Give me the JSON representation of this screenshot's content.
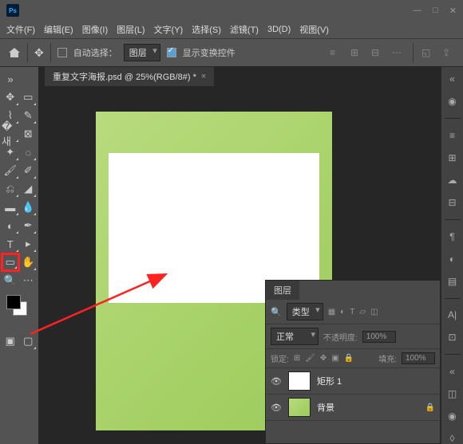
{
  "app": {
    "logo": "Ps"
  },
  "window_controls": {
    "min": "—",
    "max": "□",
    "close": "✕"
  },
  "menu": [
    "文件(F)",
    "编辑(E)",
    "图像(I)",
    "图层(L)",
    "文字(Y)",
    "选择(S)",
    "滤镜(T)",
    "3D(D)",
    "视图(V)"
  ],
  "optbar": {
    "auto_select_label": "自动选择：",
    "layer_dropdown": "图层",
    "show_transform": "显示变换控件"
  },
  "document": {
    "tab_title": "重复文字海报.psd @ 25%(RGB/8#) *"
  },
  "layers_panel": {
    "title": "图层",
    "type_label": "类型",
    "blend_mode": "正常",
    "opacity_label": "不透明度:",
    "opacity_value": "100%",
    "lock_label": "锁定:",
    "fill_label": "填充:",
    "fill_value": "100%",
    "layers": [
      {
        "name": "矩形 1"
      },
      {
        "name": "背景"
      }
    ],
    "search_icon": "🔍"
  }
}
